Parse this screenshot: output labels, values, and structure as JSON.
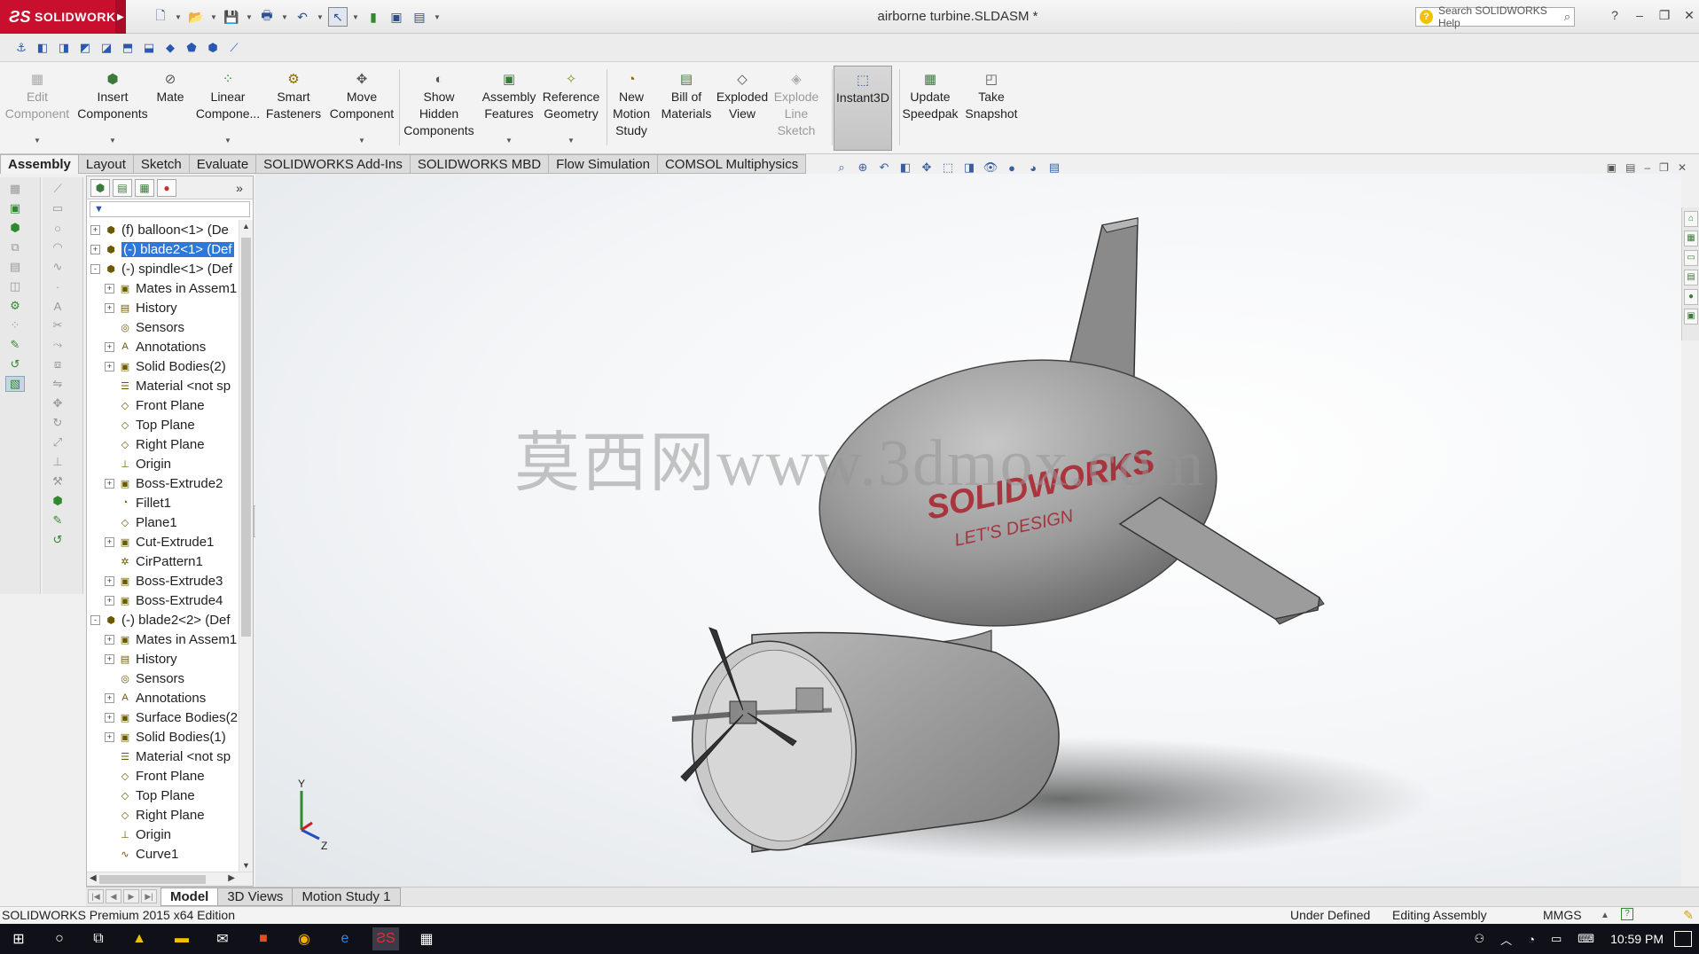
{
  "app": {
    "brand": "SOLIDWORKS",
    "document_title": "airborne turbine.SLDASM *",
    "search_placeholder": "Search SOLIDWORKS Help"
  },
  "ribbon": [
    {
      "label": "Edit Component",
      "icon": "edit-component-icon",
      "disabled": true
    },
    {
      "label": "Insert Components",
      "icon": "insert-components-icon"
    },
    {
      "label": "Mate",
      "icon": "mate-icon"
    },
    {
      "label": "Linear Compone...",
      "icon": "linear-pattern-icon"
    },
    {
      "label": "Smart Fasteners",
      "icon": "smart-fasteners-icon"
    },
    {
      "label": "Move Component",
      "icon": "move-component-icon"
    },
    {
      "label": "Show Hidden Components",
      "icon": "show-hidden-icon"
    },
    {
      "label": "Assembly Features",
      "icon": "assembly-features-icon"
    },
    {
      "label": "Reference Geometry",
      "icon": "reference-geometry-icon"
    },
    {
      "label": "New Motion Study",
      "icon": "motion-study-icon"
    },
    {
      "label": "Bill of Materials",
      "icon": "bom-icon"
    },
    {
      "label": "Exploded View",
      "icon": "exploded-view-icon"
    },
    {
      "label": "Explode Line Sketch",
      "icon": "explode-line-icon",
      "disabled": true
    },
    {
      "label": "Instant3D",
      "icon": "instant3d-icon",
      "active": true
    },
    {
      "label": "Update Speedpak",
      "icon": "speedpak-icon"
    },
    {
      "label": "Take Snapshot",
      "icon": "snapshot-icon"
    }
  ],
  "tabs": [
    "Assembly",
    "Layout",
    "Sketch",
    "Evaluate",
    "SOLIDWORKS Add-Ins",
    "SOLIDWORKS MBD",
    "Flow Simulation",
    "COMSOL Multiphysics"
  ],
  "tree": [
    {
      "label": "(f) balloon<1> (De",
      "level": 0,
      "exp": "+",
      "icon": "assembly-component-icon"
    },
    {
      "label": "(-) blade2<1> (Def",
      "level": 0,
      "exp": "+",
      "icon": "assembly-component-icon",
      "selected": true
    },
    {
      "label": "(-) spindle<1> (Def",
      "level": 0,
      "exp": "-",
      "icon": "assembly-component-icon"
    },
    {
      "label": "Mates in Assem1",
      "level": 1,
      "exp": "+",
      "icon": "mates-folder-icon"
    },
    {
      "label": "History",
      "level": 1,
      "exp": "+",
      "icon": "history-icon"
    },
    {
      "label": "Sensors",
      "level": 1,
      "exp": "",
      "icon": "sensor-icon"
    },
    {
      "label": "Annotations",
      "level": 1,
      "exp": "+",
      "icon": "annotation-icon"
    },
    {
      "label": "Solid Bodies(2)",
      "level": 1,
      "exp": "+",
      "icon": "solid-bodies-icon"
    },
    {
      "label": "Material <not sp",
      "level": 1,
      "exp": "",
      "icon": "material-icon"
    },
    {
      "label": "Front Plane",
      "level": 1,
      "exp": "",
      "icon": "plane-icon"
    },
    {
      "label": "Top Plane",
      "level": 1,
      "exp": "",
      "icon": "plane-icon"
    },
    {
      "label": "Right Plane",
      "level": 1,
      "exp": "",
      "icon": "plane-icon"
    },
    {
      "label": "Origin",
      "level": 1,
      "exp": "",
      "icon": "origin-icon"
    },
    {
      "label": "Boss-Extrude2",
      "level": 1,
      "exp": "+",
      "icon": "extrude-icon"
    },
    {
      "label": "Fillet1",
      "level": 1,
      "exp": "",
      "icon": "fillet-icon"
    },
    {
      "label": "Plane1",
      "level": 1,
      "exp": "",
      "icon": "plane-icon"
    },
    {
      "label": "Cut-Extrude1",
      "level": 1,
      "exp": "+",
      "icon": "cut-extrude-icon"
    },
    {
      "label": "CirPattern1",
      "level": 1,
      "exp": "",
      "icon": "circular-pattern-icon"
    },
    {
      "label": "Boss-Extrude3",
      "level": 1,
      "exp": "+",
      "icon": "extrude-icon"
    },
    {
      "label": "Boss-Extrude4",
      "level": 1,
      "exp": "+",
      "icon": "extrude-icon"
    },
    {
      "label": "(-) blade2<2> (Def",
      "level": 0,
      "exp": "-",
      "icon": "assembly-component-icon"
    },
    {
      "label": "Mates in Assem1",
      "level": 1,
      "exp": "+",
      "icon": "mates-folder-icon"
    },
    {
      "label": "History",
      "level": 1,
      "exp": "+",
      "icon": "history-icon"
    },
    {
      "label": "Sensors",
      "level": 1,
      "exp": "",
      "icon": "sensor-icon"
    },
    {
      "label": "Annotations",
      "level": 1,
      "exp": "+",
      "icon": "annotation-icon"
    },
    {
      "label": "Surface Bodies(2",
      "level": 1,
      "exp": "+",
      "icon": "surface-bodies-icon"
    },
    {
      "label": "Solid Bodies(1)",
      "level": 1,
      "exp": "+",
      "icon": "solid-bodies-icon"
    },
    {
      "label": "Material <not sp",
      "level": 1,
      "exp": "",
      "icon": "material-icon"
    },
    {
      "label": "Front Plane",
      "level": 1,
      "exp": "",
      "icon": "plane-icon"
    },
    {
      "label": "Top Plane",
      "level": 1,
      "exp": "",
      "icon": "plane-icon"
    },
    {
      "label": "Right Plane",
      "level": 1,
      "exp": "",
      "icon": "plane-icon"
    },
    {
      "label": "Origin",
      "level": 1,
      "exp": "",
      "icon": "origin-icon"
    },
    {
      "label": "Curve1",
      "level": 1,
      "exp": "",
      "icon": "curve-icon"
    }
  ],
  "model_decal": {
    "brand": "SOLIDWORKS",
    "tagline": "LET'S DESIGN"
  },
  "watermark": "莫西网www.3dmox.com",
  "axes": {
    "y": "Y",
    "z": "Z"
  },
  "bottom_tabs": [
    "Model",
    "3D Views",
    "Motion Study 1"
  ],
  "status": {
    "edition": "SOLIDWORKS Premium 2015 x64 Edition",
    "definition": "Under Defined",
    "mode": "Editing Assembly",
    "units": "MMGS",
    "units_caret": "▲"
  },
  "taskbar": {
    "time": "10:59 PM"
  },
  "colors": {
    "brand_red": "#c8102e",
    "selection_blue": "#2d78d8",
    "model_gray": "#8d8d8d"
  }
}
